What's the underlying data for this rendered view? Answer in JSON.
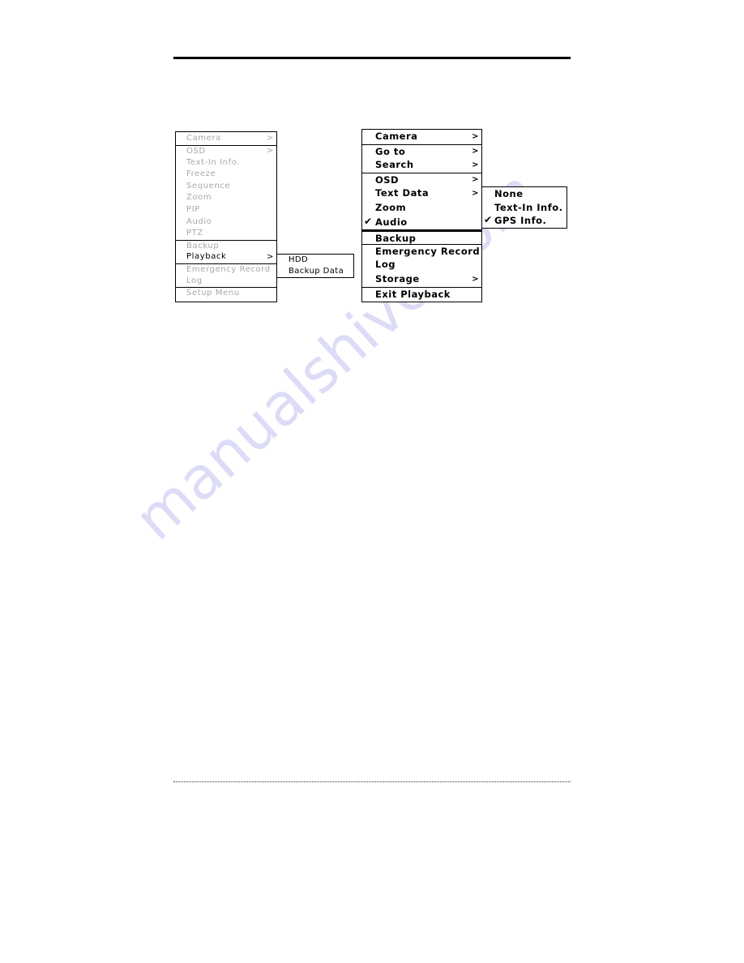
{
  "watermark": "manualshive.com",
  "left_menu": {
    "items": [
      {
        "label": "Camera",
        "enabled": false,
        "submenu": true
      },
      {
        "label": "OSD",
        "enabled": false,
        "submenu": true
      },
      {
        "label": "Text-In Info.",
        "enabled": false
      },
      {
        "label": "Freeze",
        "enabled": false
      },
      {
        "label": "Sequence",
        "enabled": false
      },
      {
        "label": "Zoom",
        "enabled": false
      },
      {
        "label": "PIP",
        "enabled": false
      },
      {
        "label": "Audio",
        "enabled": false
      },
      {
        "label": "PTZ",
        "enabled": false
      },
      {
        "label": "Backup",
        "enabled": false
      },
      {
        "label": "Playback",
        "enabled": true,
        "submenu": true
      },
      {
        "label": "Emergency Record",
        "enabled": false
      },
      {
        "label": "Log",
        "enabled": false
      },
      {
        "label": "Setup Menu",
        "enabled": false
      }
    ],
    "submenu": {
      "items": [
        {
          "label": "HDD"
        },
        {
          "label": "Backup Data"
        }
      ]
    },
    "arrow_glyph": ">"
  },
  "right_menu": {
    "items": [
      {
        "label": "Camera",
        "submenu": true
      },
      {
        "label": "Go to",
        "submenu": true
      },
      {
        "label": "Search",
        "submenu": true
      },
      {
        "label": "OSD",
        "submenu": true
      },
      {
        "label": "Text Data",
        "submenu": true
      },
      {
        "label": "Zoom"
      },
      {
        "label": "Audio",
        "checked": true
      },
      {
        "label": "Backup"
      },
      {
        "label": "Emergency Record"
      },
      {
        "label": "Log"
      },
      {
        "label": "Storage",
        "submenu": true
      },
      {
        "label": "Exit Playback"
      }
    ],
    "submenu": {
      "items": [
        {
          "label": "None",
          "checked": false
        },
        {
          "label": "Text-In Info.",
          "checked": false
        },
        {
          "label": "GPS Info.",
          "checked": true
        }
      ]
    },
    "arrow_glyph": ">",
    "check_glyph": "✔"
  }
}
